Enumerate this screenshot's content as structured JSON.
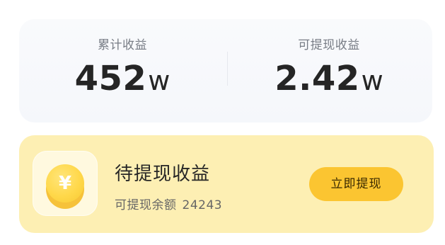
{
  "stats": {
    "total": {
      "label": "累计收益",
      "value": "452",
      "unit": "w"
    },
    "withdrawable": {
      "label": "可提现收益",
      "value": "2.42",
      "unit": "w"
    }
  },
  "pending": {
    "icon": "yen-coin-icon",
    "coin_symbol": "¥",
    "title": "待提现收益",
    "balance_label": "可提现余额",
    "balance_value": "24243",
    "button_label": "立即提现"
  },
  "colors": {
    "card_yellow": "#fdefb3",
    "button_yellow": "#fbc531",
    "coin_gold": "#ffd84a"
  }
}
